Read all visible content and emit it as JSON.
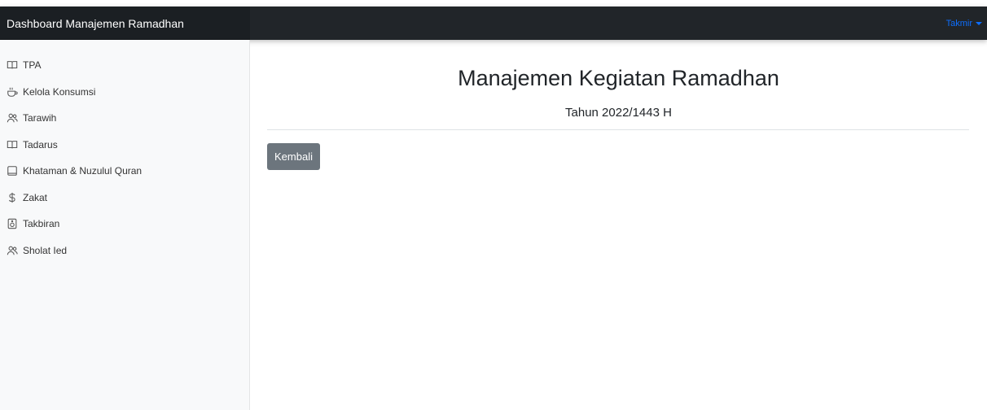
{
  "header": {
    "brand": "Dashboard Manajemen Ramadhan",
    "user_menu_label": "Takmir"
  },
  "sidebar": {
    "items": [
      {
        "label": "TPA",
        "icon": "book-icon"
      },
      {
        "label": "Kelola Konsumsi",
        "icon": "cup-icon"
      },
      {
        "label": "Tarawih",
        "icon": "users-icon"
      },
      {
        "label": "Tadarus",
        "icon": "book-icon"
      },
      {
        "label": "Khataman & Nuzulul Quran",
        "icon": "tablet-icon"
      },
      {
        "label": "Zakat",
        "icon": "dollar-icon"
      },
      {
        "label": "Takbiran",
        "icon": "speaker-icon"
      },
      {
        "label": "Sholat Ied",
        "icon": "users-icon"
      }
    ]
  },
  "main": {
    "title": "Manajemen Kegiatan Ramadhan",
    "subtitle": "Tahun 2022/1443 H",
    "back_button_label": "Kembali"
  },
  "colors": {
    "navbar": "#212529",
    "sidebar_bg": "#f8f9fa",
    "accent": "#0d6efd",
    "button_secondary": "#6c757d"
  }
}
